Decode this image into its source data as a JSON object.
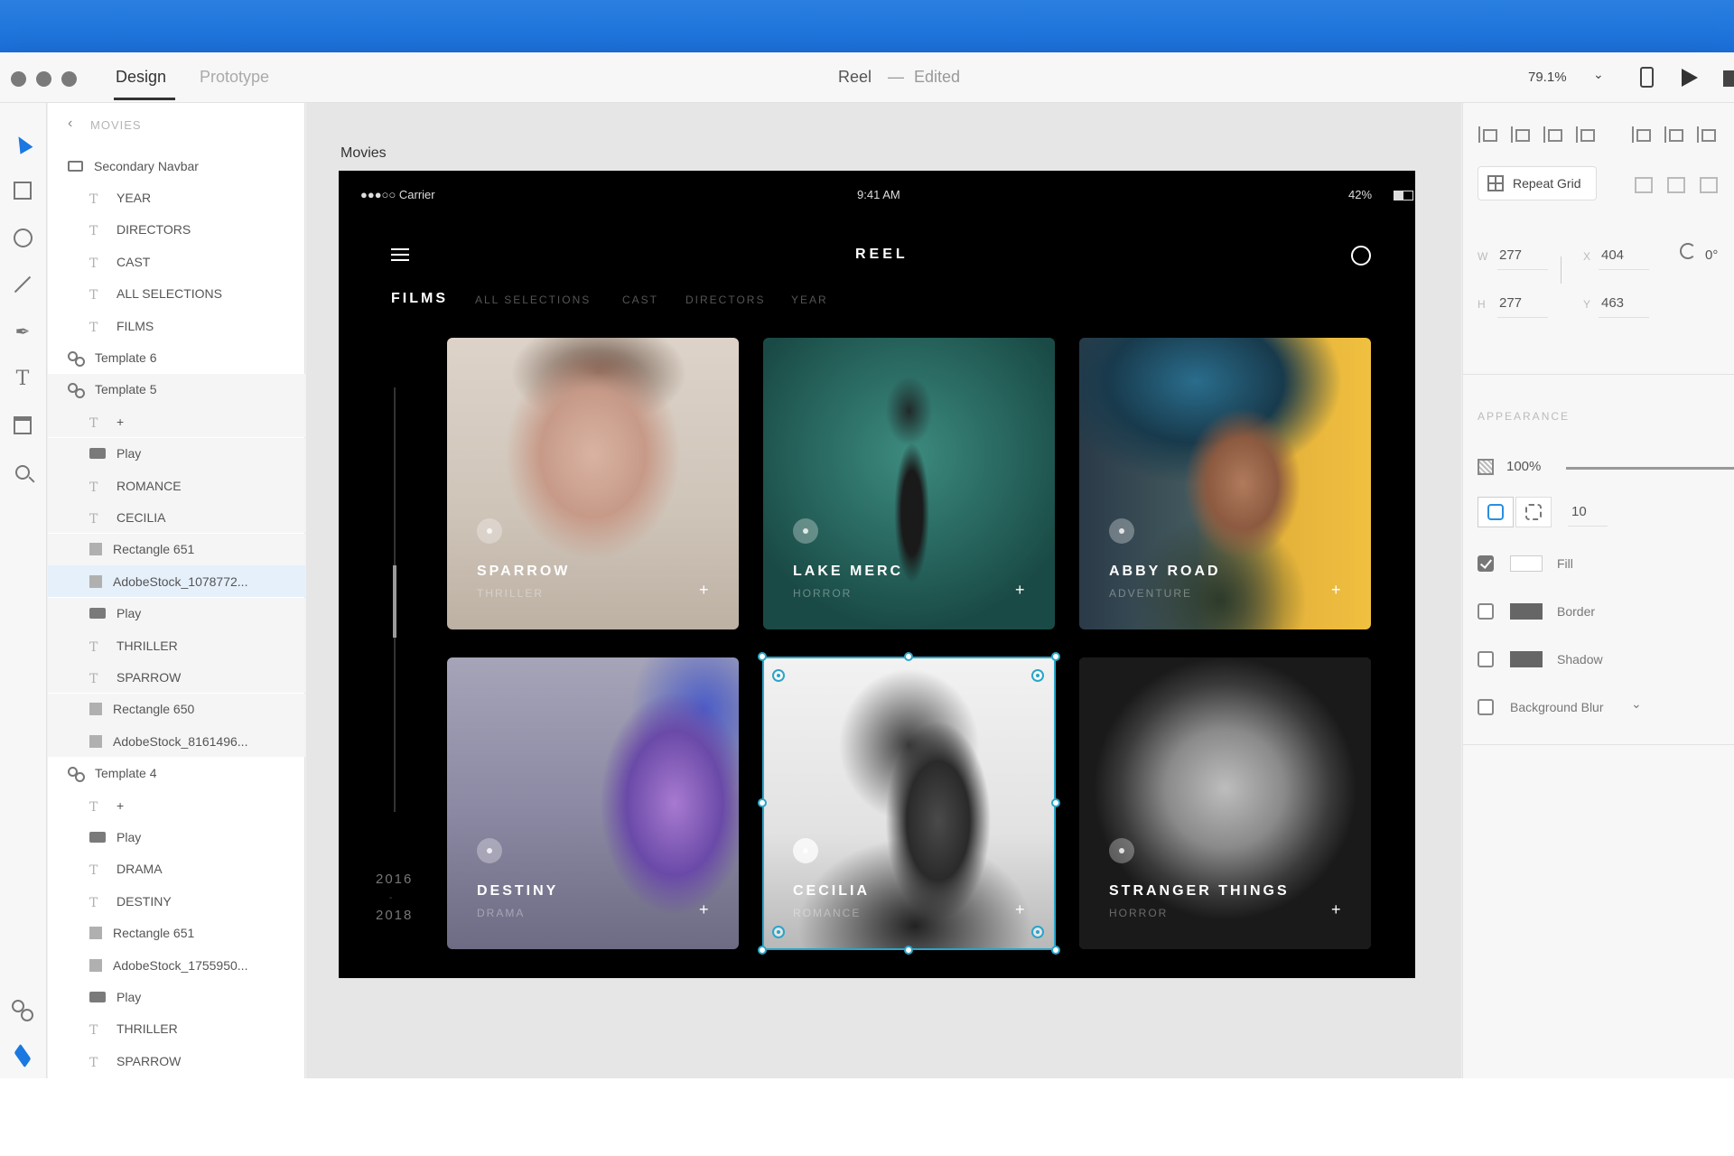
{
  "titlebar": {
    "tabs": [
      {
        "label": "Design",
        "active": true
      },
      {
        "label": "Prototype",
        "active": false
      }
    ],
    "doc_title": "Reel",
    "separator": "—",
    "doc_status": "Edited",
    "zoom": "79.1%"
  },
  "layers": {
    "header": "MOVIES",
    "items": [
      {
        "label": "Secondary Navbar",
        "icon": "folder-icon"
      },
      {
        "label": "YEAR",
        "icon": "text-icon"
      },
      {
        "label": "DIRECTORS",
        "icon": "text-icon"
      },
      {
        "label": "CAST",
        "icon": "text-icon"
      },
      {
        "label": "ALL SELECTIONS",
        "icon": "text-icon"
      },
      {
        "label": "FILMS",
        "icon": "text-icon"
      },
      {
        "label": "Template 6",
        "icon": "symbol-icon"
      },
      {
        "label": "Template 5",
        "icon": "symbol-icon"
      },
      {
        "label": "+",
        "icon": "text-icon"
      },
      {
        "label": "Play",
        "icon": "folder-filled-icon"
      },
      {
        "label": "ROMANCE",
        "icon": "text-icon"
      },
      {
        "label": "CECILIA",
        "icon": "text-icon"
      },
      {
        "label": "Rectangle 651",
        "icon": "rectangle-icon"
      },
      {
        "label": "AdobeStock_1078772...",
        "icon": "rectangle-icon"
      },
      {
        "label": "Play",
        "icon": "folder-filled-icon"
      },
      {
        "label": "THRILLER",
        "icon": "text-icon"
      },
      {
        "label": "SPARROW",
        "icon": "text-icon"
      },
      {
        "label": "Rectangle 650",
        "icon": "rectangle-icon"
      },
      {
        "label": "AdobeStock_8161496...",
        "icon": "rectangle-icon"
      },
      {
        "label": "Template 4",
        "icon": "symbol-icon"
      },
      {
        "label": "+",
        "icon": "text-icon"
      },
      {
        "label": "Play",
        "icon": "folder-filled-icon"
      },
      {
        "label": "DRAMA",
        "icon": "text-icon"
      },
      {
        "label": "DESTINY",
        "icon": "text-icon"
      },
      {
        "label": "Rectangle 651",
        "icon": "rectangle-icon"
      },
      {
        "label": "AdobeStock_1755950...",
        "icon": "rectangle-icon"
      },
      {
        "label": "Play",
        "icon": "folder-filled-icon"
      },
      {
        "label": "THRILLER",
        "icon": "text-icon"
      },
      {
        "label": "SPARROW",
        "icon": "text-icon"
      }
    ]
  },
  "canvas": {
    "artboard_label": "Movies",
    "status": {
      "carrier": "●●●○○ Carrier",
      "time": "9:41 AM",
      "battery": "42%"
    },
    "app_title": "REEL",
    "categories": [
      {
        "label": "FILMS",
        "active": true
      },
      {
        "label": "ALL SELECTIONS",
        "active": false
      },
      {
        "label": "CAST",
        "active": false
      },
      {
        "label": "DIRECTORS",
        "active": false
      },
      {
        "label": "YEAR",
        "active": false
      }
    ],
    "years": [
      "2016",
      "2018"
    ],
    "year_separator": "-",
    "cards": [
      {
        "title": "SPARROW",
        "genre": "THRILLER",
        "plus": "+"
      },
      {
        "title": "LAKE MERC",
        "genre": "HORROR",
        "plus": "+"
      },
      {
        "title": "ABBY ROAD",
        "genre": "ADVENTURE",
        "plus": "+"
      },
      {
        "title": "DESTINY",
        "genre": "DRAMA",
        "plus": "+"
      },
      {
        "title": "CECILIA",
        "genre": "ROMANCE",
        "plus": "+"
      },
      {
        "title": "STRANGER THINGS",
        "genre": "HORROR",
        "plus": "+"
      }
    ]
  },
  "inspector": {
    "repeat_grid_label": "Repeat Grid",
    "w_label": "W",
    "w_value": "277",
    "h_label": "H",
    "h_value": "277",
    "x_label": "X",
    "x_value": "404",
    "y_label": "Y",
    "y_value": "463",
    "rotation": "0°",
    "appearance_header": "APPEARANCE",
    "opacity": "100%",
    "corner_radius": "10",
    "fill_label": "Fill",
    "border_label": "Border",
    "shadow_label": "Shadow",
    "background_blur_label": "Background Blur",
    "fill_checked": true,
    "border_checked": false,
    "shadow_checked": false,
    "background_blur_checked": false
  },
  "colors": {
    "accent_blue": "#1b78e0",
    "selection": "#2aa5c9",
    "artboard_bg": "#000000"
  }
}
